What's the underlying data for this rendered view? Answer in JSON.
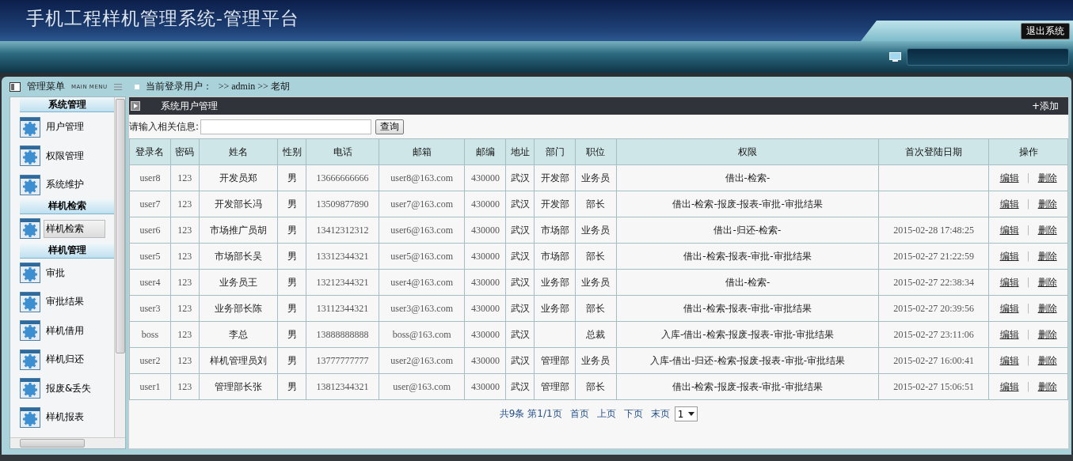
{
  "header": {
    "title": "手机工程样机管理系统-管理平台",
    "logout": "退出系统"
  },
  "menu_bar": {
    "title": "管理菜单",
    "subtitle": "MAIN MENU",
    "user_label": "当前登录用户：",
    "user_path": ">> admin >> 老胡"
  },
  "sidebar": {
    "groups": [
      {
        "title": "系统管理",
        "items": [
          {
            "label": "用户管理",
            "selected": false
          },
          {
            "label": "权限管理",
            "selected": false
          },
          {
            "label": "系统维护",
            "selected": false
          }
        ]
      },
      {
        "title": "样机检索",
        "items": [
          {
            "label": "样机检索",
            "selected": true
          }
        ]
      },
      {
        "title": "样机管理",
        "items": [
          {
            "label": "审批",
            "selected": false
          },
          {
            "label": "审批结果",
            "selected": false
          },
          {
            "label": "样机借用",
            "selected": false
          },
          {
            "label": "样机归还",
            "selected": false
          },
          {
            "label": "报废&丢失",
            "selected": false
          },
          {
            "label": "样机报表",
            "selected": false
          }
        ]
      }
    ]
  },
  "panel": {
    "title": "系统用户管理",
    "add": "+添加"
  },
  "search": {
    "label": "请输入相关信息:",
    "button": "查询"
  },
  "table": {
    "columns": [
      "登录名",
      "密码",
      "姓名",
      "性别",
      "电话",
      "邮箱",
      "邮编",
      "地址",
      "部门",
      "职位",
      "权限",
      "首次登陆日期",
      "操作"
    ],
    "rows": [
      [
        "user8",
        "123",
        "开发员郑",
        "男",
        "13666666666",
        "user8@163.com",
        "430000",
        "武汉",
        "开发部",
        "业务员",
        "借出-检索-",
        "",
        "编辑",
        "|",
        "删除"
      ],
      [
        "user7",
        "123",
        "开发部长冯",
        "男",
        "13509877890",
        "user7@163.com",
        "430000",
        "武汉",
        "开发部",
        "部长",
        "借出-检索-报废-报表-审批-审批结果",
        "",
        "编辑",
        "|",
        "删除"
      ],
      [
        "user6",
        "123",
        "市场推广员胡",
        "男",
        "13412312312",
        "user6@163.com",
        "430000",
        "武汉",
        "市场部",
        "业务员",
        "借出-归还-检索-",
        "2015-02-28 17:48:25",
        "编辑",
        "|",
        "删除"
      ],
      [
        "user5",
        "123",
        "市场部长吴",
        "男",
        "13312344321",
        "user5@163.com",
        "430000",
        "武汉",
        "市场部",
        "部长",
        "借出-检索-报表-审批-审批结果",
        "2015-02-27 21:22:59",
        "编辑",
        "|",
        "删除"
      ],
      [
        "user4",
        "123",
        "业务员王",
        "男",
        "13212344321",
        "user4@163.com",
        "430000",
        "武汉",
        "业务部",
        "业务员",
        "借出-检索-",
        "2015-02-27 22:38:34",
        "编辑",
        "|",
        "删除"
      ],
      [
        "user3",
        "123",
        "业务部长陈",
        "男",
        "13112344321",
        "user3@163.com",
        "430000",
        "武汉",
        "业务部",
        "部长",
        "借出-检索-报表-审批-审批结果",
        "2015-02-27 20:39:56",
        "编辑",
        "|",
        "删除"
      ],
      [
        "boss",
        "123",
        "李总",
        "男",
        "13888888888",
        "boss@163.com",
        "430000",
        "武汉",
        "",
        "总裁",
        "入库-借出-检索-报废-报表-审批-审批结果",
        "2015-02-27 23:11:06",
        "编辑",
        "|",
        "删除"
      ],
      [
        "user2",
        "123",
        "样机管理员刘",
        "男",
        "13777777777",
        "user2@163.com",
        "430000",
        "武汉",
        "管理部",
        "业务员",
        "入库-借出-归还-检索-报废-报表-审批-审批结果",
        "2015-02-27 16:00:41",
        "编辑",
        "|",
        "删除"
      ],
      [
        "user1",
        "123",
        "管理部长张",
        "男",
        "13812344321",
        "user@163.com",
        "430000",
        "武汉",
        "管理部",
        "部长",
        "借出-检索-报废-报表-审批-审批结果",
        "2015-02-27 15:06:51",
        "编辑",
        "|",
        "删除"
      ]
    ]
  },
  "pagination": {
    "summary": "共9条",
    "page": "第1/1页",
    "links": [
      "首页",
      "上页",
      "下页",
      "末页"
    ],
    "page_select": "1"
  }
}
